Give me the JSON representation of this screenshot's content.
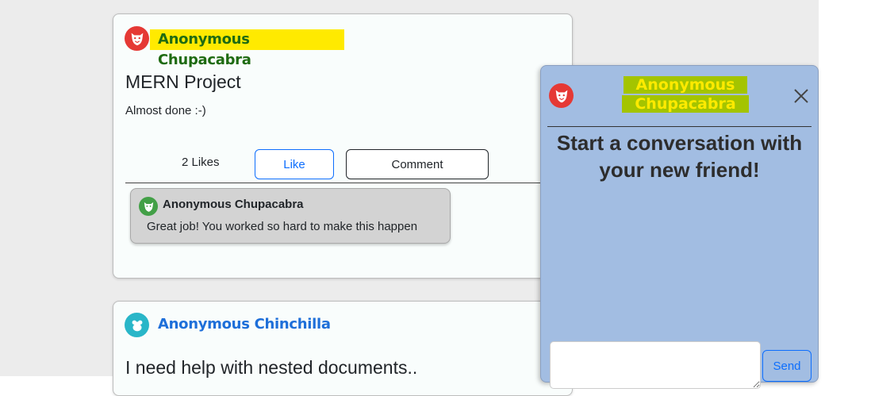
{
  "posts": [
    {
      "author": "Anonymous Chupacabra",
      "title": "MERN Project",
      "body": "Almost done :-)",
      "likes_text": "2 Likes",
      "like_label": "Like",
      "comment_label": "Comment",
      "comments": [
        {
          "author": "Anonymous Chupacabra",
          "text": "Great job! You worked so hard to make this happen"
        }
      ]
    },
    {
      "author": "Anonymous Chinchilla",
      "title": "I need help with nested documents.."
    }
  ],
  "chat": {
    "name": "Anonymous Chupacabra",
    "prompt": "Start a conversation with your new friend!",
    "input_value": "",
    "send_label": "Send"
  },
  "icons": {
    "post_author_avatar": "chupacabra-avatar-icon",
    "chinchilla_avatar": "chinchilla-avatar-icon",
    "close": "close-icon"
  },
  "colors": {
    "highlight_yellow": "#ffea00",
    "author_green": "#1f6b12",
    "author_blue": "#1e6fd9",
    "chat_bg": "#a2bde2",
    "chat_name_bg": "#a4c400",
    "primary": "#0d6efd"
  }
}
